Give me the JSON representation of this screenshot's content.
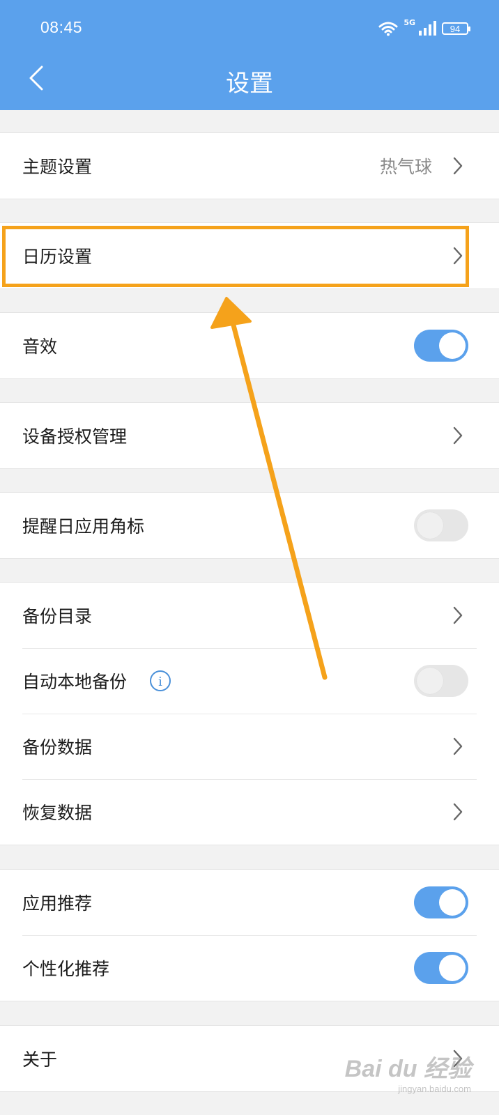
{
  "status_bar": {
    "time": "08:45",
    "network": "5G",
    "battery": "94"
  },
  "header": {
    "title": "设置",
    "back_icon": "chevron-left-icon",
    "background_color": "#5ba1ec"
  },
  "settings": {
    "theme": {
      "label": "主题设置",
      "value": "热气球"
    },
    "calendar": {
      "label": "日历设置"
    },
    "sound": {
      "label": "音效",
      "enabled": true
    },
    "device_auth": {
      "label": "设备授权管理"
    },
    "badge": {
      "label": "提醒日应用角标",
      "enabled": false
    },
    "backup_dir": {
      "label": "备份目录"
    },
    "auto_backup": {
      "label": "自动本地备份",
      "info_icon": "ⓘ",
      "enabled": false
    },
    "backup_data": {
      "label": "备份数据"
    },
    "restore_data": {
      "label": "恢复数据"
    },
    "app_recommend": {
      "label": "应用推荐",
      "enabled": true
    },
    "personalized": {
      "label": "个性化推荐",
      "enabled": true
    },
    "about": {
      "label": "关于"
    }
  },
  "annotation": {
    "highlight_color": "#f5a21b",
    "arrow_color": "#f5a21b"
  },
  "watermark": {
    "main": "Bai du 经验",
    "sub": "jingyan.baidu.com"
  }
}
